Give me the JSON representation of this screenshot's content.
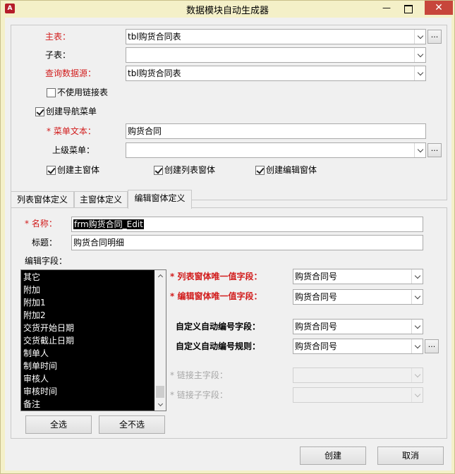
{
  "window": {
    "title": "数据模块自动生成器",
    "app_icon": "A",
    "minimize_glyph": "—",
    "close_glyph": "✕"
  },
  "main": {
    "main_table": {
      "label": "主表：",
      "value": "tbl购货合同表"
    },
    "sub_table": {
      "label": "子表：",
      "value": ""
    },
    "query_source": {
      "label": "查询数据源：",
      "value": "tbl购货合同表"
    },
    "no_link_table": {
      "label": "不使用链接表",
      "checked": false
    },
    "create_nav_menu": {
      "label": "创建导航菜单",
      "checked": true
    },
    "menu_text": {
      "label": "* 菜单文本：",
      "value": "购货合同"
    },
    "parent_menu": {
      "label": "上级菜单：",
      "value": ""
    },
    "create_main_form": {
      "label": "创建主窗体",
      "checked": true
    },
    "create_list_form": {
      "label": "创建列表窗体",
      "checked": true
    },
    "create_edit_form": {
      "label": "创建编辑窗体",
      "checked": true
    },
    "ellipsis": "..."
  },
  "tabs": [
    {
      "label": "列表窗体定义",
      "active": false
    },
    {
      "label": "主窗体定义",
      "active": false
    },
    {
      "label": "编辑窗体定义",
      "active": true
    }
  ],
  "edit_tab": {
    "name": {
      "label": "* 名称：",
      "value": "frm购货合同_Edit"
    },
    "caption": {
      "label": "标题：",
      "value": "购货合同明细"
    },
    "fields_label": "编辑字段：",
    "fields": [
      "其它",
      "附加",
      "附加1",
      "附加2",
      "交货开始日期",
      "交货截止日期",
      "制单人",
      "制单时间",
      "审核人",
      "审核时间",
      "备注"
    ],
    "list_unique_field": {
      "label": "* 列表窗体唯一值字段：",
      "value": "购货合同号"
    },
    "edit_unique_field": {
      "label": "* 编辑窗体唯一值字段：",
      "value": "购货合同号"
    },
    "auto_number_field": {
      "label": "自定义自动编号字段：",
      "value": "购货合同号"
    },
    "auto_number_rule": {
      "label": "自定义自动编号规则：",
      "value": "购货合同号"
    },
    "link_master_field": {
      "label": "* 链接主字段：",
      "value": ""
    },
    "link_child_field": {
      "label": "* 链接子字段：",
      "value": ""
    },
    "select_all": "全选",
    "select_none": "全不选"
  },
  "footer": {
    "create": "创建",
    "cancel": "取消"
  }
}
